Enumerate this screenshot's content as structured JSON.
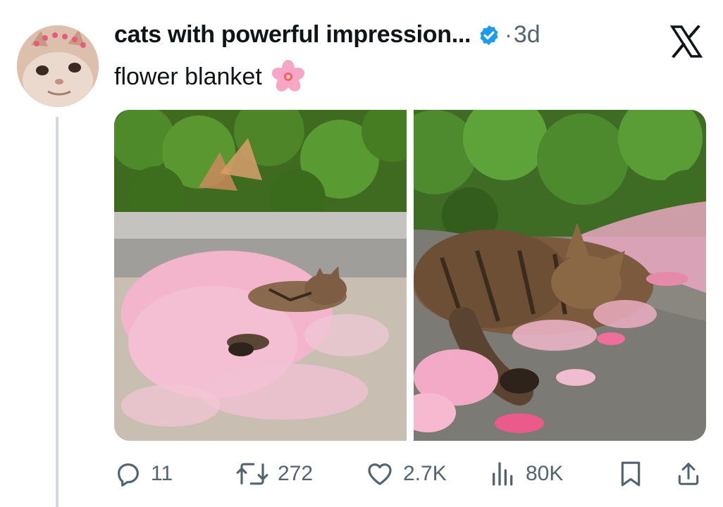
{
  "post": {
    "author_name": "cats with powerful impression...",
    "verified": true,
    "separator": "·",
    "time_ago": "3d",
    "text": "flower blanket",
    "emoji": "🌸",
    "media": [
      {
        "description": "cat-under-petals-left"
      },
      {
        "description": "cat-on-petals-right"
      }
    ]
  },
  "actions": {
    "replies": "11",
    "reposts": "272",
    "likes": "2.7K",
    "views": "80K"
  },
  "icons": {
    "reply": "reply-icon",
    "repost": "repost-icon",
    "like": "heart-icon",
    "views": "views-icon",
    "bookmark": "bookmark-icon",
    "share": "share-icon",
    "app": "x-logo-icon",
    "verified": "verified-badge-icon"
  },
  "colors": {
    "text": "#0f1419",
    "secondary": "#536471",
    "verified": "#1d9bf0",
    "petal": "#f6b8cd"
  }
}
